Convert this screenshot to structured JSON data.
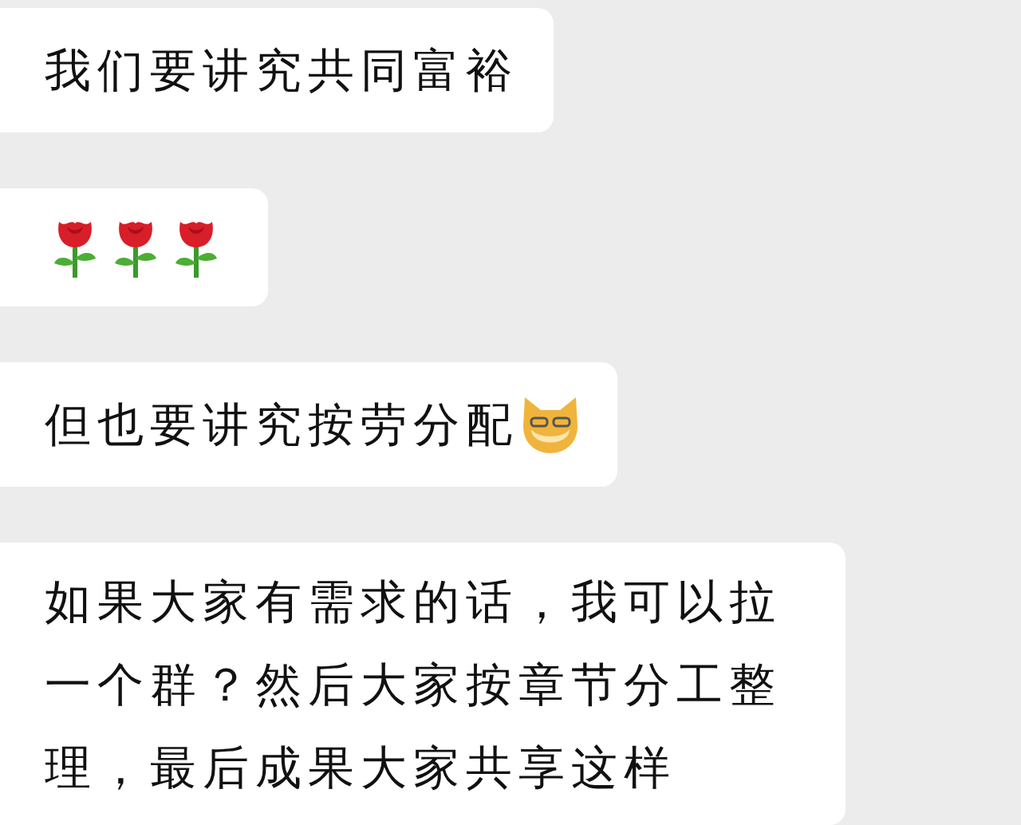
{
  "messages": [
    {
      "kind": "text",
      "text": "我们要讲究共同富裕"
    },
    {
      "kind": "stickers",
      "stickers": [
        {
          "kind": "rose"
        },
        {
          "kind": "rose"
        },
        {
          "kind": "rose"
        }
      ]
    },
    {
      "kind": "text",
      "text": "但也要讲究按劳分配",
      "trailing_emoji": {
        "kind": "cat"
      }
    },
    {
      "kind": "text",
      "text": "如果大家有需求的话，我可以拉一个群？然后大家按章节分工整理，最后成果大家共享这样"
    }
  ]
}
